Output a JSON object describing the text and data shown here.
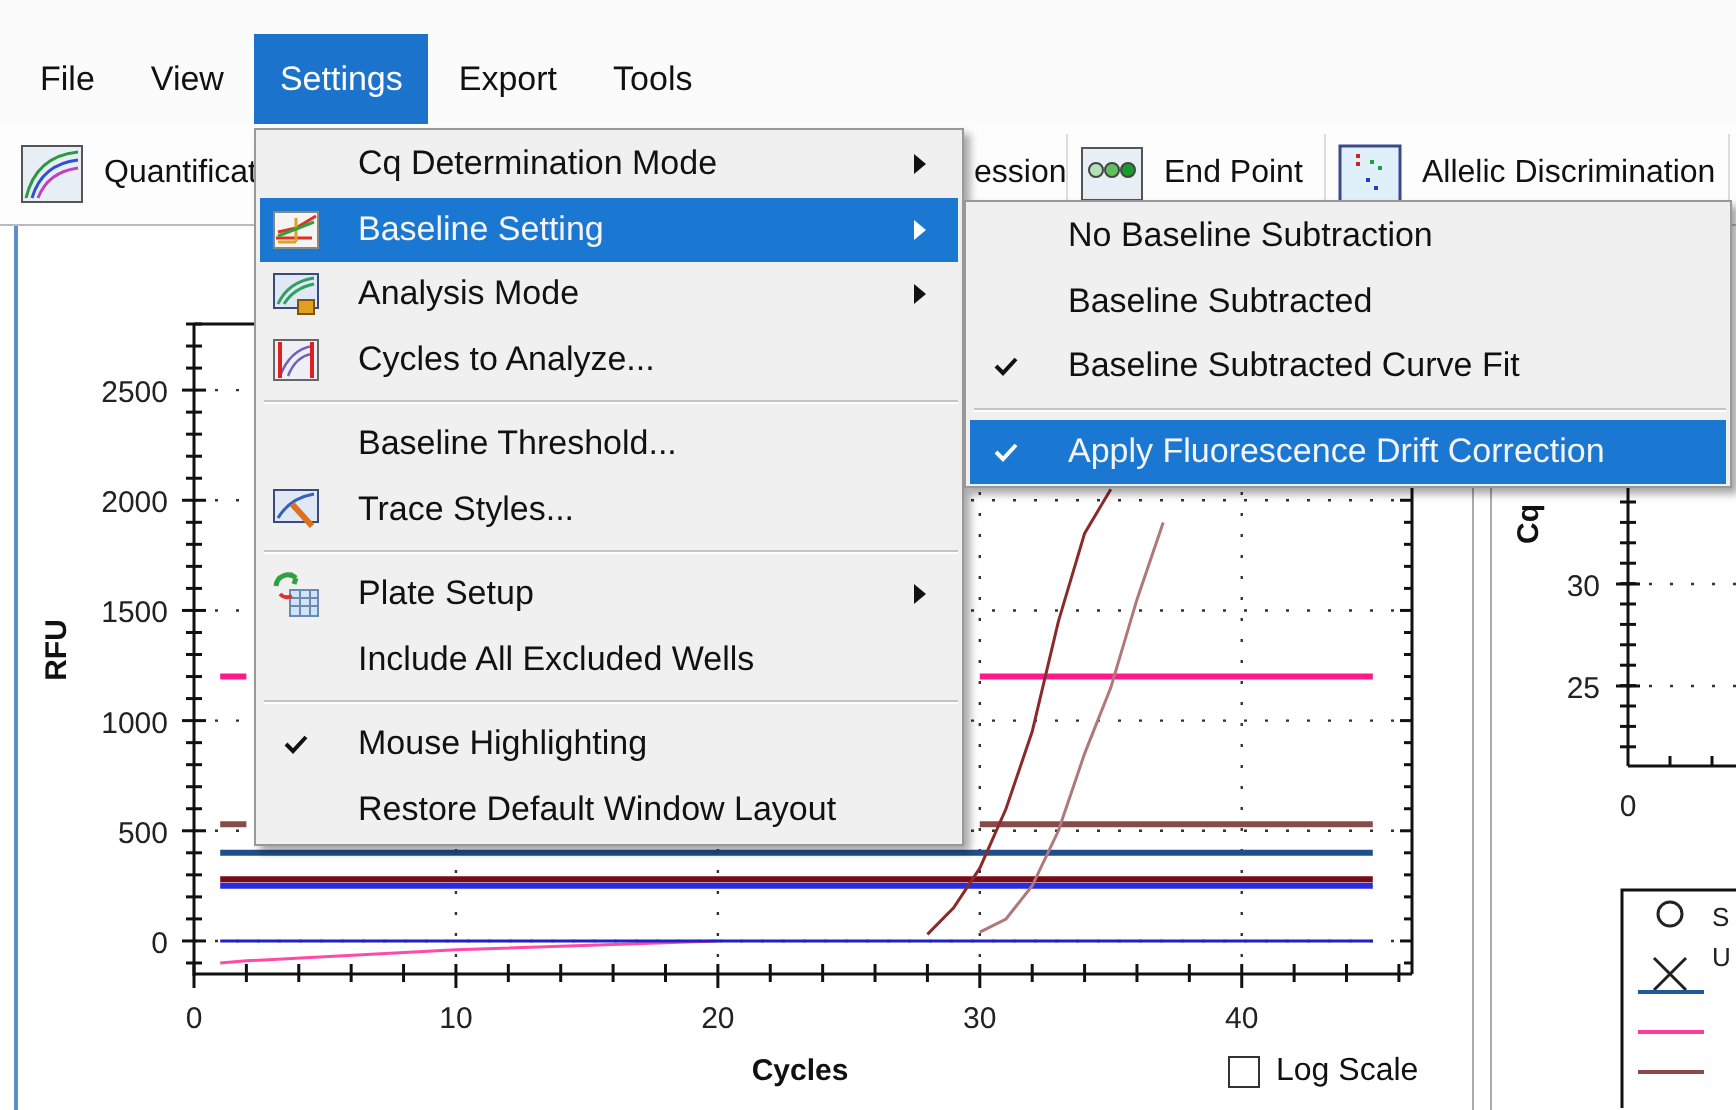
{
  "menu_bar": [
    {
      "label": "File",
      "selected": false
    },
    {
      "label": "View",
      "selected": false
    },
    {
      "label": "Settings",
      "selected": true
    },
    {
      "label": "Export",
      "selected": false
    },
    {
      "label": "Tools",
      "selected": false
    }
  ],
  "toolbar_tabs": [
    {
      "label": "Quantificat"
    },
    {
      "label": "ession"
    },
    {
      "label": "End Point"
    },
    {
      "label": "Allelic Discrimination"
    }
  ],
  "settings_menu": [
    {
      "kind": "item",
      "label": "Cq Determination Mode",
      "has_submenu": true,
      "selected": false,
      "checked": false
    },
    {
      "kind": "item",
      "label": "Baseline Setting",
      "has_submenu": true,
      "selected": true,
      "checked": false,
      "submenu": [
        {
          "kind": "item",
          "label": "No Baseline Subtraction",
          "selected": false,
          "checked": false
        },
        {
          "kind": "item",
          "label": "Baseline Subtracted",
          "selected": false,
          "checked": false
        },
        {
          "kind": "item",
          "label": "Baseline Subtracted Curve Fit",
          "selected": false,
          "checked": true
        },
        {
          "kind": "separator"
        },
        {
          "kind": "item",
          "label": "Apply Fluorescence Drift Correction",
          "selected": true,
          "checked": true
        }
      ]
    },
    {
      "kind": "item",
      "label": "Analysis Mode",
      "has_submenu": true,
      "selected": false,
      "checked": false
    },
    {
      "kind": "item",
      "label": "Cycles to Analyze...",
      "has_submenu": false,
      "selected": false,
      "checked": false
    },
    {
      "kind": "separator"
    },
    {
      "kind": "item",
      "label": "Baseline Threshold...",
      "has_submenu": false,
      "selected": false,
      "checked": false
    },
    {
      "kind": "item",
      "label": "Trace Styles...",
      "has_submenu": false,
      "selected": false,
      "checked": false
    },
    {
      "kind": "separator"
    },
    {
      "kind": "item",
      "label": "Plate Setup",
      "has_submenu": true,
      "selected": false,
      "checked": false
    },
    {
      "kind": "item",
      "label": "Include All Excluded Wells",
      "has_submenu": false,
      "selected": false,
      "checked": false
    },
    {
      "kind": "separator"
    },
    {
      "kind": "item",
      "label": "Mouse Highlighting",
      "has_submenu": false,
      "selected": false,
      "checked": true
    },
    {
      "kind": "item",
      "label": "Restore Default Window Layout",
      "has_submenu": false,
      "selected": false,
      "checked": false
    }
  ],
  "amplification_chart": {
    "log_scale": {
      "label": "Log Scale",
      "checked": false
    },
    "chart_data": {
      "type": "line",
      "xlabel": "Cycles",
      "ylabel": "RFU",
      "grid": true,
      "x": [
        1,
        2,
        10,
        20,
        27,
        28,
        29,
        30,
        31,
        32,
        33,
        34,
        35,
        36,
        37,
        38,
        39,
        40,
        45
      ],
      "xlim": [
        0,
        46.5
      ],
      "ylim": [
        -150,
        2800
      ],
      "xticks": [
        0,
        10,
        20,
        30,
        40
      ],
      "yticks": [
        0,
        500,
        1000,
        1500,
        2000,
        2500
      ],
      "series": [
        {
          "color": "#ff1a8c",
          "values": [
            1200,
            1200,
            null,
            null,
            null,
            null,
            null,
            1200,
            1200,
            1200,
            1200,
            1200,
            1200,
            1200,
            1200,
            1200,
            1200,
            1200,
            1200
          ]
        },
        {
          "color": "#8b4a4a",
          "values": [
            530,
            530,
            null,
            null,
            null,
            null,
            null,
            530,
            530,
            530,
            530,
            530,
            530,
            530,
            530,
            530,
            530,
            530,
            530
          ]
        },
        {
          "color": "#1f4e8c",
          "values": [
            400,
            400,
            400,
            400,
            400,
            400,
            400,
            400,
            400,
            400,
            400,
            400,
            400,
            400,
            400,
            400,
            400,
            400,
            400
          ]
        },
        {
          "color": "#2a2ae0",
          "values": [
            250,
            250,
            250,
            250,
            250,
            250,
            250,
            250,
            250,
            250,
            250,
            250,
            250,
            250,
            250,
            250,
            250,
            250,
            250
          ]
        },
        {
          "color": "#7a0a14",
          "values": [
            280,
            280,
            280,
            280,
            280,
            280,
            280,
            280,
            280,
            280,
            280,
            280,
            280,
            280,
            280,
            280,
            280,
            280,
            280
          ]
        },
        {
          "color": "#ff4aa8",
          "values": [
            -100,
            -90,
            -40,
            0,
            null,
            null,
            null,
            null,
            null,
            null,
            null,
            null,
            null,
            null,
            null,
            null,
            null,
            null,
            null
          ]
        },
        {
          "color": "#2020c8",
          "values": [
            0,
            0,
            0,
            0,
            0,
            0,
            0,
            0,
            0,
            0,
            0,
            0,
            0,
            0,
            0,
            0,
            0,
            0,
            0
          ]
        },
        {
          "color": "#8b2a2a",
          "values": [
            null,
            null,
            null,
            null,
            null,
            30,
            150,
            330,
            600,
            950,
            1450,
            1850,
            2050,
            null,
            null,
            null,
            null,
            null,
            null
          ]
        },
        {
          "color": "#b07878",
          "values": [
            null,
            null,
            null,
            null,
            null,
            null,
            null,
            40,
            100,
            250,
            500,
            850,
            1150,
            1550,
            1900,
            null,
            null,
            null,
            null
          ]
        }
      ]
    }
  },
  "cq_chart": {
    "ylabel": "Cq",
    "yticks": [
      "30",
      "25"
    ],
    "xticks": [
      "0"
    ]
  },
  "legend": [
    {
      "kind": "circle",
      "label": "S"
    },
    {
      "kind": "cross",
      "label": "U"
    },
    {
      "kind": "line",
      "color": "#1f5a9a"
    },
    {
      "kind": "line",
      "color": "#ff3d9a"
    },
    {
      "kind": "line",
      "color": "#8b4a4a"
    }
  ]
}
